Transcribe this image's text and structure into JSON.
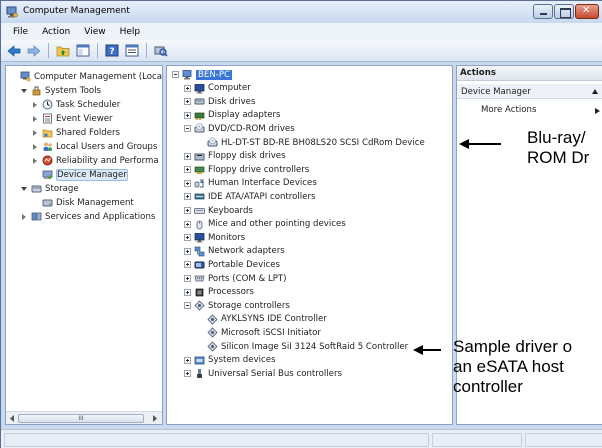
{
  "window": {
    "title": "Computer Management"
  },
  "menu": [
    "File",
    "Action",
    "View",
    "Help"
  ],
  "left_tree": [
    {
      "label": "Computer Management (Local",
      "level": 0,
      "expander": "none",
      "icon": "computer-management-icon",
      "selected": false
    },
    {
      "label": "System Tools",
      "level": 1,
      "expander": "open",
      "icon": "tools-icon",
      "selected": false
    },
    {
      "label": "Task Scheduler",
      "level": 2,
      "expander": "closed",
      "icon": "clock-icon",
      "selected": false
    },
    {
      "label": "Event Viewer",
      "level": 2,
      "expander": "closed",
      "icon": "event-viewer-icon",
      "selected": false
    },
    {
      "label": "Shared Folders",
      "level": 2,
      "expander": "closed",
      "icon": "shared-folder-icon",
      "selected": false
    },
    {
      "label": "Local Users and Groups",
      "level": 2,
      "expander": "closed",
      "icon": "users-icon",
      "selected": false
    },
    {
      "label": "Reliability and Performa",
      "level": 2,
      "expander": "closed",
      "icon": "performance-icon",
      "selected": false
    },
    {
      "label": "Device Manager",
      "level": 2,
      "expander": "none",
      "icon": "device-manager-icon",
      "selected": true
    },
    {
      "label": "Storage",
      "level": 1,
      "expander": "open",
      "icon": "storage-icon",
      "selected": false
    },
    {
      "label": "Disk Management",
      "level": 2,
      "expander": "none",
      "icon": "disk-icon",
      "selected": false
    },
    {
      "label": "Services and Applications",
      "level": 1,
      "expander": "closed",
      "icon": "services-icon",
      "selected": false
    }
  ],
  "device_tree": [
    {
      "label": "BEN-PC",
      "level": 0,
      "expander": "minus",
      "icon": "computer-icon",
      "selected": true
    },
    {
      "label": "Computer",
      "level": 1,
      "expander": "plus",
      "icon": "monitor-icon"
    },
    {
      "label": "Disk drives",
      "level": 1,
      "expander": "plus",
      "icon": "disk-drive-icon"
    },
    {
      "label": "Display adapters",
      "level": 1,
      "expander": "plus",
      "icon": "display-adapter-icon"
    },
    {
      "label": "DVD/CD-ROM drives",
      "level": 1,
      "expander": "minus",
      "icon": "dvd-icon"
    },
    {
      "label": "HL-DT-ST BD-RE  BH08LS20 SCSI CdRom Device",
      "level": 2,
      "expander": "none",
      "icon": "dvd-icon"
    },
    {
      "label": "Floppy disk drives",
      "level": 1,
      "expander": "plus",
      "icon": "floppy-icon"
    },
    {
      "label": "Floppy drive controllers",
      "level": 1,
      "expander": "plus",
      "icon": "floppy-controller-icon"
    },
    {
      "label": "Human Interface Devices",
      "level": 1,
      "expander": "plus",
      "icon": "hid-icon"
    },
    {
      "label": "IDE ATA/ATAPI controllers",
      "level": 1,
      "expander": "plus",
      "icon": "ide-icon"
    },
    {
      "label": "Keyboards",
      "level": 1,
      "expander": "plus",
      "icon": "keyboard-icon"
    },
    {
      "label": "Mice and other pointing devices",
      "level": 1,
      "expander": "plus",
      "icon": "mouse-icon"
    },
    {
      "label": "Monitors",
      "level": 1,
      "expander": "plus",
      "icon": "monitor-icon"
    },
    {
      "label": "Network adapters",
      "level": 1,
      "expander": "plus",
      "icon": "network-icon"
    },
    {
      "label": "Portable Devices",
      "level": 1,
      "expander": "plus",
      "icon": "portable-device-icon"
    },
    {
      "label": "Ports (COM & LPT)",
      "level": 1,
      "expander": "plus",
      "icon": "port-icon"
    },
    {
      "label": "Processors",
      "level": 1,
      "expander": "plus",
      "icon": "processor-icon"
    },
    {
      "label": "Storage controllers",
      "level": 1,
      "expander": "minus",
      "icon": "storage-controller-icon"
    },
    {
      "label": "AYKLSYNS IDE Controller",
      "level": 2,
      "expander": "none",
      "icon": "storage-controller-icon"
    },
    {
      "label": "Microsoft iSCSI Initiator",
      "level": 2,
      "expander": "none",
      "icon": "storage-controller-icon"
    },
    {
      "label": "Silicon Image SiI 3124 SoftRaid 5 Controller",
      "level": 2,
      "expander": "none",
      "icon": "storage-controller-icon"
    },
    {
      "label": "System devices",
      "level": 1,
      "expander": "plus",
      "icon": "system-device-icon"
    },
    {
      "label": "Universal Serial Bus controllers",
      "level": 1,
      "expander": "plus",
      "icon": "usb-icon"
    }
  ],
  "actions": {
    "header": "Actions",
    "section": "Device Manager",
    "link": "More Actions"
  },
  "annotations": {
    "bluray_line1": "Blu-ray/",
    "bluray_line2": "ROM Dr",
    "sample_line1": "Sample driver o",
    "sample_line2": "an eSATA host",
    "sample_line3": "controller"
  },
  "scrollbar": {
    "thumb_label": "III"
  },
  "colors": {
    "selection": "#3875d7",
    "frame": "#c9daf0",
    "tree_select": "#dceaf7"
  }
}
